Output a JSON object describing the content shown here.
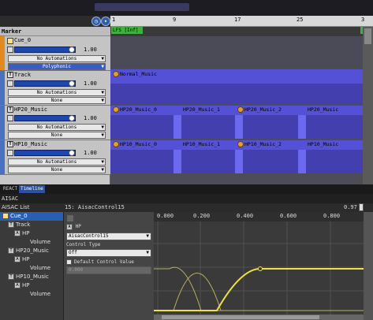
{
  "timeline": {
    "marker_label": "Marker",
    "lfs_label": "LFS [Inf]",
    "ruler_ticks": [
      "1",
      "9",
      "17",
      "25",
      "3"
    ],
    "tracks": [
      {
        "name": "Cue_0",
        "volume": "1.00",
        "automation": "No Automations",
        "mode": "Polyphonic"
      },
      {
        "name": "Track",
        "volume": "1.00",
        "automation": "No Automations",
        "mode": "None"
      },
      {
        "name": "HP20_Music",
        "volume": "1.00",
        "automation": "No Automations",
        "mode": "None"
      },
      {
        "name": "HP10_Music",
        "volume": "1.00",
        "automation": "No Automations",
        "mode": "None"
      }
    ],
    "clips": {
      "normal": [
        "Normal_Music"
      ],
      "hp20": [
        "HP20_Music_0",
        "HP20_Music_1",
        "HP20_Music_2",
        "HP20_Music"
      ],
      "hp10": [
        "HP10_Music_0",
        "HP10_Music_1",
        "HP10_Music_2",
        "HP10_Music"
      ]
    }
  },
  "tabs": [
    "REACT",
    "Timeline"
  ],
  "aisac": {
    "header": "AISAC",
    "list_title": "AISAC List",
    "tree": [
      "Cue_0",
      "Track",
      "HP",
      "Volume",
      "HP20_Music",
      "HP",
      "Volume",
      "HP10_Music",
      "HP",
      "Volume"
    ],
    "props_title": "15: AisacControl15",
    "control_name": "AisacControl15",
    "hp_label": "HP",
    "control_type_label": "Control Type",
    "control_type_value": "Off",
    "default_control_label": "Default Control Value",
    "default_control_value": "0.000",
    "graph_ticks": [
      "0.000",
      "0.200",
      "0.400",
      "0.600",
      "0.800"
    ],
    "slider_value": "0.97"
  },
  "colors": {
    "lane": "#5450d8",
    "curve_active": "#f0e040",
    "curve_inactive": "#c8c060",
    "selected": "#2a5fb0"
  }
}
